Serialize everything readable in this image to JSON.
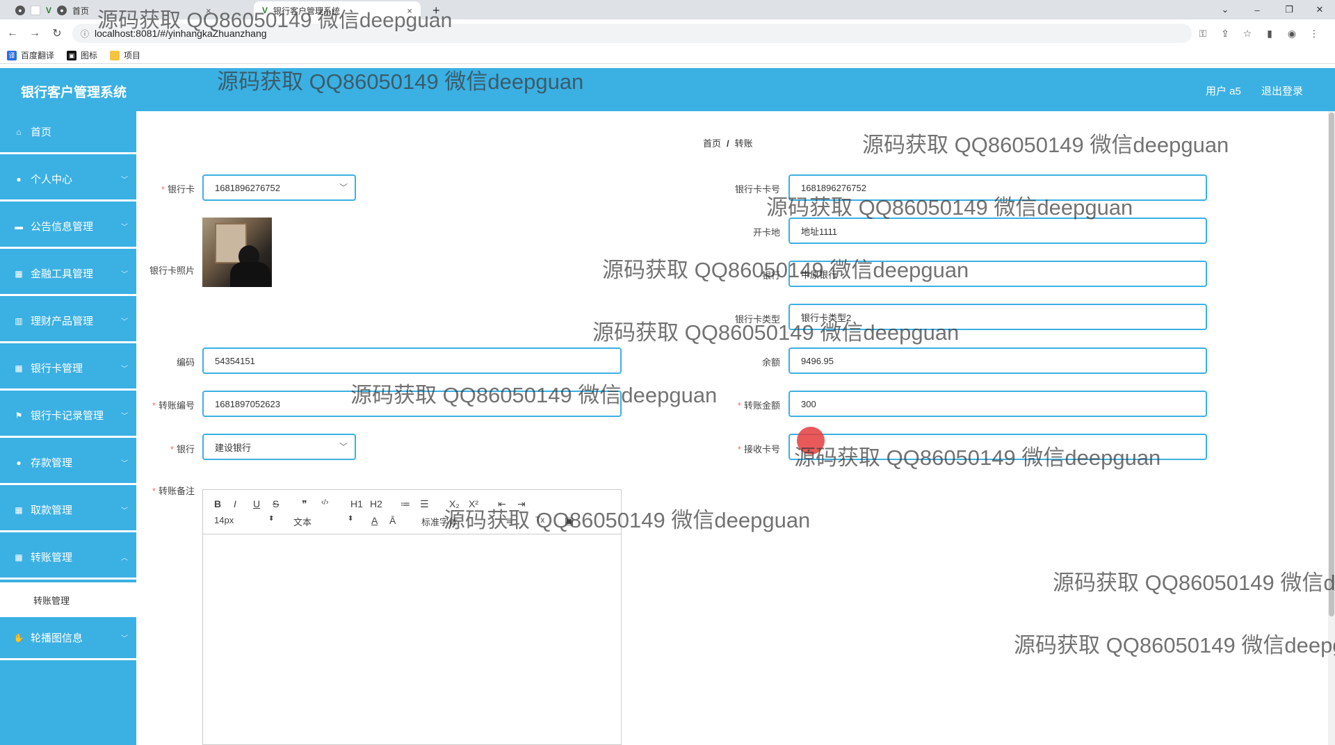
{
  "browser": {
    "tabs": [
      {
        "title": "首页",
        "active": false
      },
      {
        "title": "银行客户管理系统",
        "active": true
      }
    ],
    "new_tab": "+",
    "url": "localhost:8081/#/yinhangkaZhuanzhang",
    "bookmarks": [
      "百度翻译",
      "图标",
      "项目"
    ]
  },
  "header": {
    "title": "银行客户管理系统",
    "user": "用户 a5",
    "logout": "退出登录",
    "accent_color": "#3bb0e3"
  },
  "sidebar": {
    "items": [
      {
        "label": "首页",
        "icon": "home-icon",
        "has_submenu": false
      },
      {
        "label": "个人中心",
        "icon": "user-icon",
        "has_submenu": true
      },
      {
        "label": "公告信息管理",
        "icon": "message-icon",
        "has_submenu": true
      },
      {
        "label": "金融工具管理",
        "icon": "grid-icon",
        "has_submenu": true
      },
      {
        "label": "理财产品管理",
        "icon": "bar-chart-icon",
        "has_submenu": true
      },
      {
        "label": "银行卡管理",
        "icon": "grid-icon",
        "has_submenu": true
      },
      {
        "label": "银行卡记录管理",
        "icon": "flag-icon",
        "has_submenu": true
      },
      {
        "label": "存款管理",
        "icon": "user-icon",
        "has_submenu": true
      },
      {
        "label": "取款管理",
        "icon": "grid-icon",
        "has_submenu": true
      },
      {
        "label": "转账管理",
        "icon": "grid-icon",
        "has_submenu": true
      },
      {
        "label": "轮播图信息",
        "icon": "thumb-icon",
        "has_submenu": true
      }
    ],
    "open_submenu_item": "转账管理"
  },
  "breadcrumb": {
    "home": "首页",
    "separator": "/",
    "current": "转账"
  },
  "form": {
    "bank_card": {
      "label": "银行卡",
      "required": true,
      "value": "1681896276752"
    },
    "card_photo": {
      "label": "银行卡照片"
    },
    "code": {
      "label": "编码",
      "value": "54354151"
    },
    "transfer_no": {
      "label": "转账编号",
      "required": true,
      "value": "1681897052623"
    },
    "bank": {
      "label": "银行",
      "required": true,
      "value": "建设银行"
    },
    "card_number": {
      "label": "银行卡卡号",
      "value": "1681896276752"
    },
    "open_place": {
      "label": "开卡地",
      "value": "地址1111"
    },
    "bank_name": {
      "label": "银行",
      "value": "中原银行"
    },
    "card_type": {
      "label": "银行卡类型",
      "value": "银行卡类型2"
    },
    "balance": {
      "label": "余额",
      "value": "9496.95"
    },
    "amount": {
      "label": "转账金额",
      "required": true,
      "value": "300"
    },
    "receiver": {
      "label": "接收卡号",
      "required": true,
      "value": ""
    },
    "remark": {
      "label": "转账备注",
      "required": true
    }
  },
  "editor": {
    "font_size": "14px",
    "format": "文本",
    "font": "标准字体",
    "buttons": [
      "B",
      "I",
      "U",
      "S",
      "❞",
      "‹/›",
      "H1",
      "H2",
      "≔",
      "☰",
      "X₂",
      "X²",
      "⇤",
      "⇥",
      "A",
      "Ā",
      "≡",
      "Tx",
      "▣"
    ]
  },
  "watermark": "源码获取 QQ86050149 微信deepguan"
}
